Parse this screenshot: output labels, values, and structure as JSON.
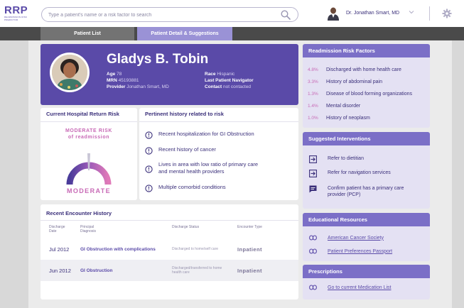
{
  "app": {
    "logo": "RRP",
    "logo_subtitle": "READMISSION RISK PREDICTOR"
  },
  "search": {
    "placeholder": "Type a patient's name or a risk factor to search",
    "icon": "search-icon"
  },
  "user": {
    "name": "Dr. Jonathan Smart, MD"
  },
  "tabs": [
    {
      "label": "Patient List",
      "active": false
    },
    {
      "label": "Patient Detail & Suggestions",
      "active": true
    }
  ],
  "patient": {
    "name": "Gladys B. Tobin",
    "age_label": "Age",
    "age": "78",
    "mrn_label": "MRN",
    "mrn": "45193881",
    "provider_label": "Provider",
    "provider": "Jonathan Smart, MD",
    "race_label": "Race",
    "race": "Hispanic",
    "navigator_label": "Last Patient Navigator",
    "contact_label": "Contact",
    "contact": "not contacted"
  },
  "return_risk": {
    "title": "Current Hospital Return Risk",
    "level_line1": "MODERATE RISK",
    "level_line2": "of readmission",
    "level_word": "MODERATE"
  },
  "history": {
    "title": "Pertinent history related to risk",
    "items": [
      "Recent hospitalization for GI Obstruction",
      "Recent history of cancer",
      "Lives in area with low ratio of primary care and mental health providers",
      "Multiple comorbid conditions"
    ]
  },
  "encounters": {
    "title": "Recent Encounter History",
    "headers": [
      "Discharge Date",
      "Principal Diagnosis",
      "Discharge Status",
      "Encounter Type"
    ],
    "rows": [
      {
        "date": "Jul 2012",
        "diagnosis": "GI Obstruction with complications",
        "status": "Discharged to home/self care",
        "type": "Inpatient"
      },
      {
        "date": "Jun 2012",
        "diagnosis": "GI Obstruction",
        "status": "Discharged/transferred to home health care",
        "type": "Inpatient"
      }
    ]
  },
  "risk_factors": {
    "title": "Readmission Risk Factors",
    "items": [
      {
        "pct": "4.8%",
        "label": "Discharged with home health care"
      },
      {
        "pct": "3.3%",
        "label": "History of abdominal pain"
      },
      {
        "pct": "1.3%",
        "label": "Disease of blood forming organizations"
      },
      {
        "pct": "1.4%",
        "label": "Mental disorder"
      },
      {
        "pct": "1.0%",
        "label": "History of neoplasm"
      }
    ]
  },
  "interventions": {
    "title": "Suggested Interventions",
    "items": [
      {
        "icon": "arrow-right-box-icon",
        "label": "Refer to dietitian"
      },
      {
        "icon": "arrow-right-box-icon",
        "label": "Refer for navigation services"
      },
      {
        "icon": "chat-bubble-icon",
        "label": "Confirm patient has a primary care provider (PCP)"
      }
    ]
  },
  "education": {
    "title": "Educational Resources",
    "links": [
      "American Cancer Society",
      "Patient Preferences Passport"
    ]
  },
  "prescriptions": {
    "title": "Prescriptions",
    "links": [
      "Go to current Medication List"
    ]
  },
  "colors": {
    "brand": "#5a4aa8",
    "accent": "#c86ab6",
    "side_header": "#7b6fc7",
    "side_bg": "#e4e1f3"
  }
}
